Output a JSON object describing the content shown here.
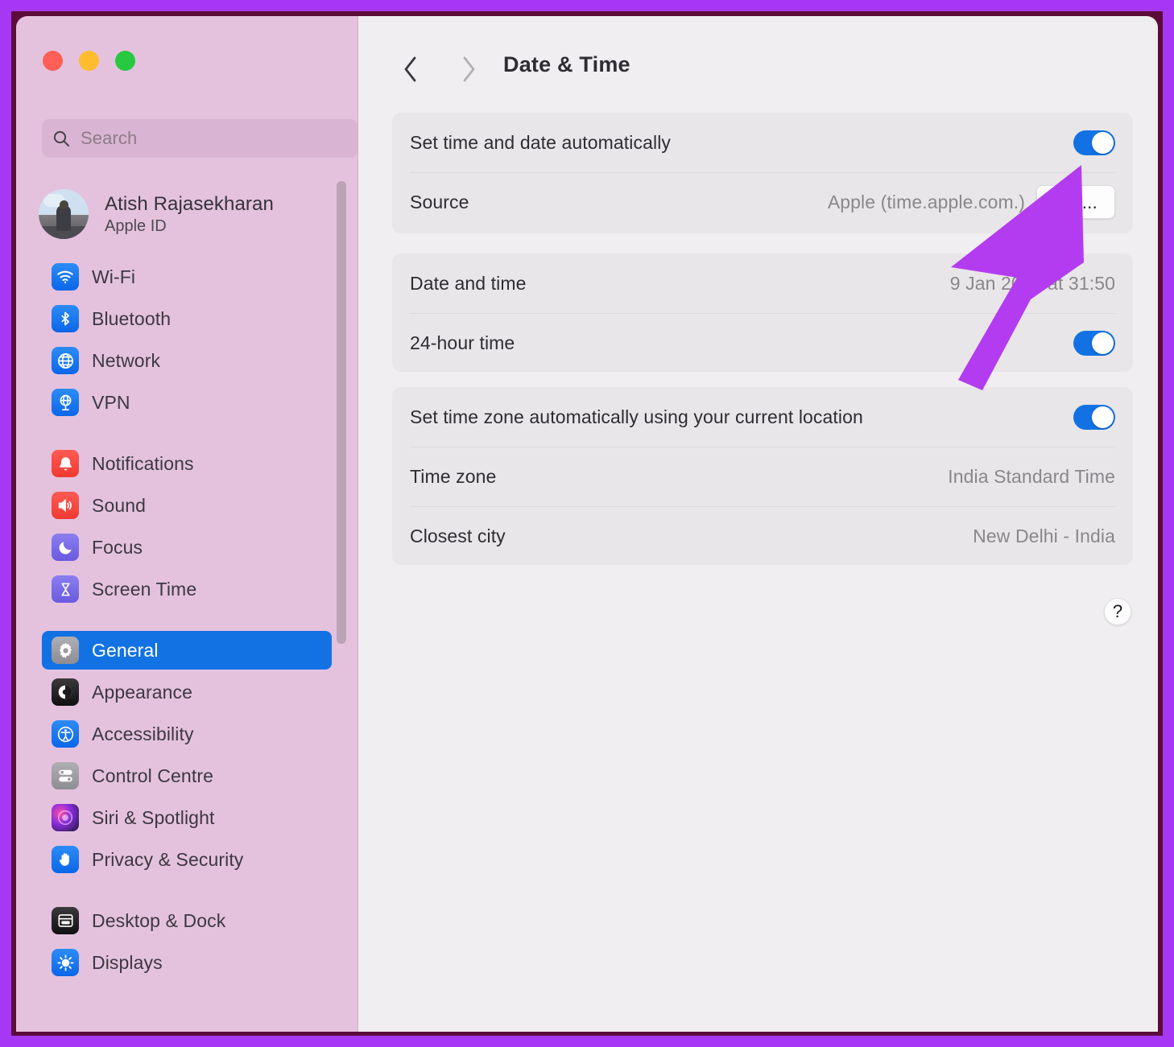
{
  "window": {
    "traffic_lights": [
      "close",
      "minimize",
      "zoom"
    ],
    "colors": {
      "accent_blue": "#1272e4",
      "sidebar_bg": "#e4c2de",
      "content_bg": "#f0eef0",
      "card_bg": "#e8e6e8",
      "annotation_purple": "#b43cf0",
      "frame_outer": "#a638f5",
      "frame_inner": "#5c0b3b"
    }
  },
  "sidebar": {
    "search": {
      "placeholder": "Search",
      "value": "",
      "icon": "search-icon"
    },
    "profile": {
      "name": "Atish Rajasekharan",
      "subtitle": "Apple ID",
      "avatar": "user-avatar"
    },
    "groups": [
      {
        "items": [
          {
            "label": "Wi-Fi",
            "icon": "wifi-icon",
            "selected": false
          },
          {
            "label": "Bluetooth",
            "icon": "bluetooth-icon",
            "selected": false
          },
          {
            "label": "Network",
            "icon": "network-icon",
            "selected": false
          },
          {
            "label": "VPN",
            "icon": "vpn-icon",
            "selected": false
          }
        ]
      },
      {
        "items": [
          {
            "label": "Notifications",
            "icon": "bell-icon",
            "selected": false
          },
          {
            "label": "Sound",
            "icon": "speaker-icon",
            "selected": false
          },
          {
            "label": "Focus",
            "icon": "moon-icon",
            "selected": false
          },
          {
            "label": "Screen Time",
            "icon": "hourglass-icon",
            "selected": false
          }
        ]
      },
      {
        "items": [
          {
            "label": "General",
            "icon": "gear-icon",
            "selected": true
          },
          {
            "label": "Appearance",
            "icon": "appearance-icon",
            "selected": false
          },
          {
            "label": "Accessibility",
            "icon": "accessibility-icon",
            "selected": false
          },
          {
            "label": "Control Centre",
            "icon": "sliders-icon",
            "selected": false
          },
          {
            "label": "Siri & Spotlight",
            "icon": "siri-icon",
            "selected": false
          },
          {
            "label": "Privacy & Security",
            "icon": "hand-icon",
            "selected": false
          }
        ]
      },
      {
        "items": [
          {
            "label": "Desktop & Dock",
            "icon": "desktop-icon",
            "selected": false
          },
          {
            "label": "Displays",
            "icon": "brightness-icon",
            "selected": false
          }
        ]
      }
    ]
  },
  "header": {
    "title": "Date & Time",
    "back_icon": "chevron-left-icon",
    "forward_icon": "chevron-right-icon"
  },
  "content": {
    "cards": [
      {
        "name": "auto-time-card",
        "rows": [
          {
            "label": "Set time and date automatically",
            "value": "",
            "control": "toggle",
            "toggle_on": true
          },
          {
            "label": "Source",
            "value": "Apple (time.apple.com.)",
            "control": "button",
            "button_label": "Set..."
          }
        ]
      },
      {
        "name": "date-time-card",
        "rows": [
          {
            "label": "Date and time",
            "value": "9 Jan 2024 at 31:50",
            "control": "none"
          },
          {
            "label": "24-hour time",
            "value": "",
            "control": "toggle",
            "toggle_on": true
          }
        ]
      },
      {
        "name": "time-zone-card",
        "rows": [
          {
            "label": "Set time zone automatically using your current location",
            "value": "",
            "control": "toggle",
            "toggle_on": true
          },
          {
            "label": "Time zone",
            "value": "India Standard Time",
            "control": "none"
          },
          {
            "label": "Closest city",
            "value": "New Delhi - India",
            "control": "none"
          }
        ]
      }
    ],
    "help_button": {
      "label": "?",
      "icon": "help-icon"
    }
  },
  "annotation": {
    "type": "arrow",
    "points_to": "set-button",
    "color": "#b43cf0"
  }
}
